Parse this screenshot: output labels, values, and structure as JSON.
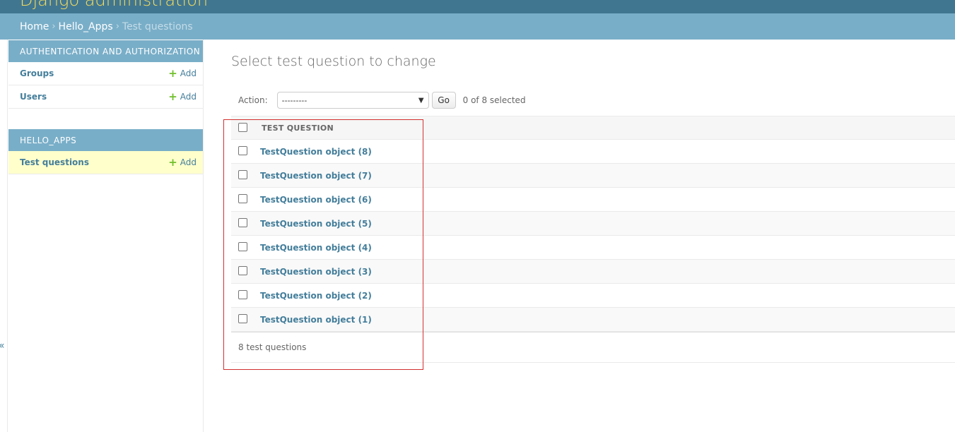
{
  "header": {
    "site_name": "Django administration"
  },
  "breadcrumbs": {
    "home": "Home",
    "app": "Hello_Apps",
    "current": "Test questions",
    "separator": "›"
  },
  "sidebar": {
    "toggle_glyph": "«",
    "modules": [
      {
        "caption": "AUTHENTICATION AND AUTHORIZATION",
        "rows": [
          {
            "label": "Groups",
            "add": "Add"
          },
          {
            "label": "Users",
            "add": "Add"
          }
        ]
      },
      {
        "caption": "HELLO_APPS",
        "rows": [
          {
            "label": "Test questions",
            "add": "Add"
          }
        ]
      }
    ]
  },
  "main": {
    "title": "Select test question to change",
    "action_label": "Action:",
    "action_selected": "---------",
    "go_label": "Go",
    "selected_count": "0 of 8 selected",
    "column_header": "TEST QUESTION",
    "rows": [
      "TestQuestion object (8)",
      "TestQuestion object (7)",
      "TestQuestion object (6)",
      "TestQuestion object (5)",
      "TestQuestion object (4)",
      "TestQuestion object (3)",
      "TestQuestion object (2)",
      "TestQuestion object (1)"
    ],
    "footer": "8 test questions"
  },
  "colors": {
    "header_bg": "#417690",
    "breadcrumbs_bg": "#79aec8",
    "site_name": "#f5dd5d",
    "link": "#447e9b",
    "add_icon": "#70bf2b",
    "selected_row": "#ffffcc",
    "annotation": "#d32f2f"
  }
}
